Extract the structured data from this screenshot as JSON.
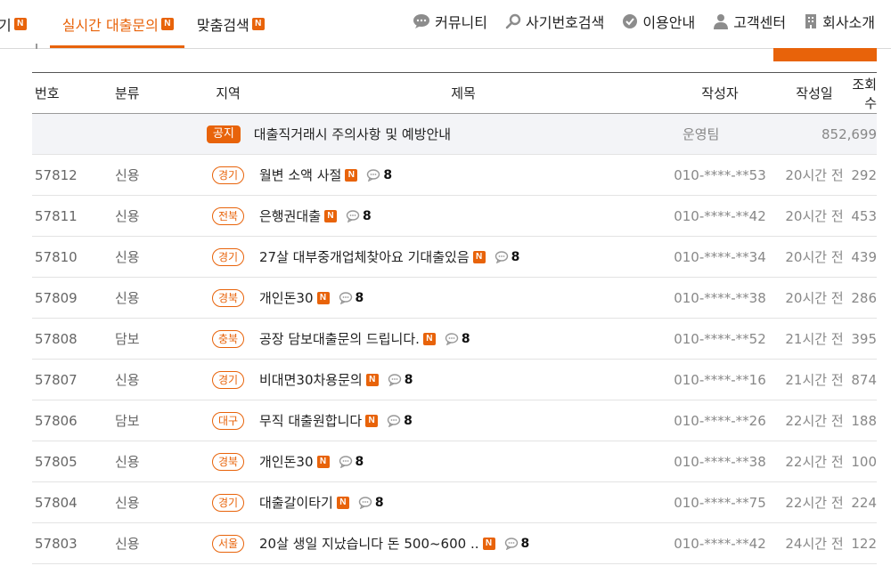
{
  "nav": {
    "left_items": [
      {
        "label": "기",
        "badge": "N",
        "active": false
      },
      {
        "label": "실시간 대출문의",
        "badge": "N",
        "active": true
      },
      {
        "label": "맞춤검색",
        "badge": "N",
        "active": false
      }
    ],
    "right_links": [
      {
        "label": "커뮤니티",
        "icon": "chat-icon"
      },
      {
        "label": "사기번호검색",
        "icon": "search-icon"
      },
      {
        "label": "이용안내",
        "icon": "check-circle-icon"
      },
      {
        "label": "고객센터",
        "icon": "person-icon"
      },
      {
        "label": "회사소개",
        "icon": "building-icon"
      }
    ]
  },
  "colors": {
    "accent": "#e8630a"
  },
  "table": {
    "headers": {
      "num": "번호",
      "cat": "분류",
      "region": "지역",
      "title": "제목",
      "author": "작성자",
      "date": "작성일",
      "views": "조회수"
    },
    "notice": {
      "region": "공지",
      "title": "대출직거래시 주의사항 및 예방안내",
      "author": "운영팀",
      "views": "852,699"
    },
    "rows": [
      {
        "num": "57812",
        "cat": "신용",
        "region": "경기",
        "title": "월변 소액 사절",
        "badge": "N",
        "comments": "8",
        "author": "010-****-**53",
        "date": "20시간 전",
        "views": "292"
      },
      {
        "num": "57811",
        "cat": "신용",
        "region": "전북",
        "title": "은행권대출",
        "badge": "N",
        "comments": "8",
        "author": "010-****-**42",
        "date": "20시간 전",
        "views": "453"
      },
      {
        "num": "57810",
        "cat": "신용",
        "region": "경기",
        "title": "27살 대부중개업체찾아요 기대출있음",
        "badge": "N",
        "comments": "8",
        "author": "010-****-**34",
        "date": "20시간 전",
        "views": "439"
      },
      {
        "num": "57809",
        "cat": "신용",
        "region": "경북",
        "title": "개인돈30",
        "badge": "N",
        "comments": "8",
        "author": "010-****-**38",
        "date": "20시간 전",
        "views": "286"
      },
      {
        "num": "57808",
        "cat": "담보",
        "region": "충북",
        "title": "공장 담보대출문의 드립니다.",
        "badge": "N",
        "comments": "8",
        "author": "010-****-**52",
        "date": "21시간 전",
        "views": "395"
      },
      {
        "num": "57807",
        "cat": "신용",
        "region": "경기",
        "title": "비대면30차용문의",
        "badge": "N",
        "comments": "8",
        "author": "010-****-**16",
        "date": "21시간 전",
        "views": "874"
      },
      {
        "num": "57806",
        "cat": "담보",
        "region": "대구",
        "title": "무직 대출원합니다",
        "badge": "N",
        "comments": "8",
        "author": "010-****-**26",
        "date": "22시간 전",
        "views": "188"
      },
      {
        "num": "57805",
        "cat": "신용",
        "region": "경북",
        "title": "개인돈30",
        "badge": "N",
        "comments": "8",
        "author": "010-****-**38",
        "date": "22시간 전",
        "views": "100"
      },
      {
        "num": "57804",
        "cat": "신용",
        "region": "경기",
        "title": "대출갈이타기",
        "badge": "N",
        "comments": "8",
        "author": "010-****-**75",
        "date": "22시간 전",
        "views": "224"
      },
      {
        "num": "57803",
        "cat": "신용",
        "region": "서울",
        "title": "20살 생일 지났습니다 돈 500~600 ..",
        "badge": "N",
        "comments": "8",
        "author": "010-****-**42",
        "date": "24시간 전",
        "views": "122"
      }
    ]
  }
}
